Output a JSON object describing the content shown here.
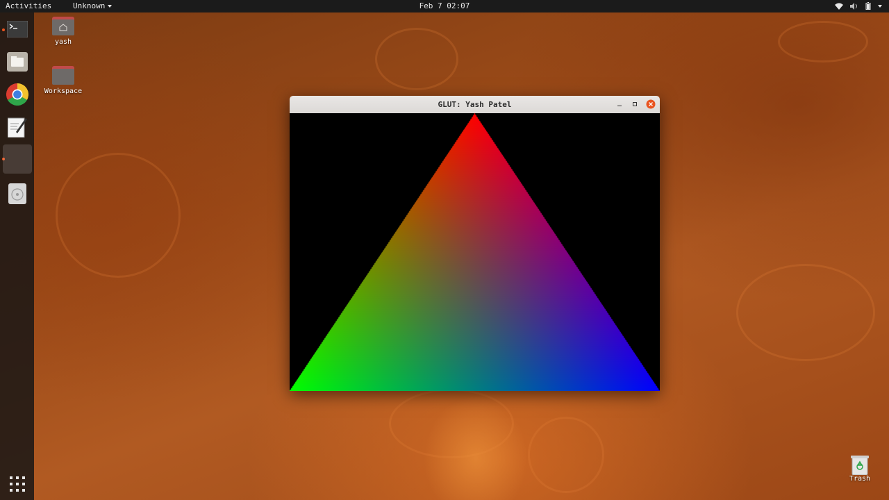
{
  "topbar": {
    "activities": "Activities",
    "app_menu": "Unknown",
    "clock": "Feb 7  02:07"
  },
  "dock": {
    "items": [
      {
        "name": "terminal",
        "running": true
      },
      {
        "name": "files",
        "running": false
      },
      {
        "name": "chrome",
        "running": false
      },
      {
        "name": "text-editor",
        "running": false
      },
      {
        "name": "glut-app",
        "running": true,
        "active": true
      },
      {
        "name": "disc",
        "running": false
      }
    ],
    "show_apps": "show-applications-icon"
  },
  "desktop": {
    "icons": [
      {
        "label": "yash",
        "icon": "home-folder-icon"
      },
      {
        "label": "Workspace",
        "icon": "folder-icon"
      }
    ],
    "trash_label": "Trash"
  },
  "window": {
    "title": "GLUT: Yash Patel",
    "background": "#000000",
    "triangle": {
      "top_color": "#ff0000",
      "left_color": "#00ff00",
      "right_color": "#0000ff"
    }
  },
  "colors": {
    "accent": "#e95420",
    "topbar_bg": "#1b1b1b"
  }
}
